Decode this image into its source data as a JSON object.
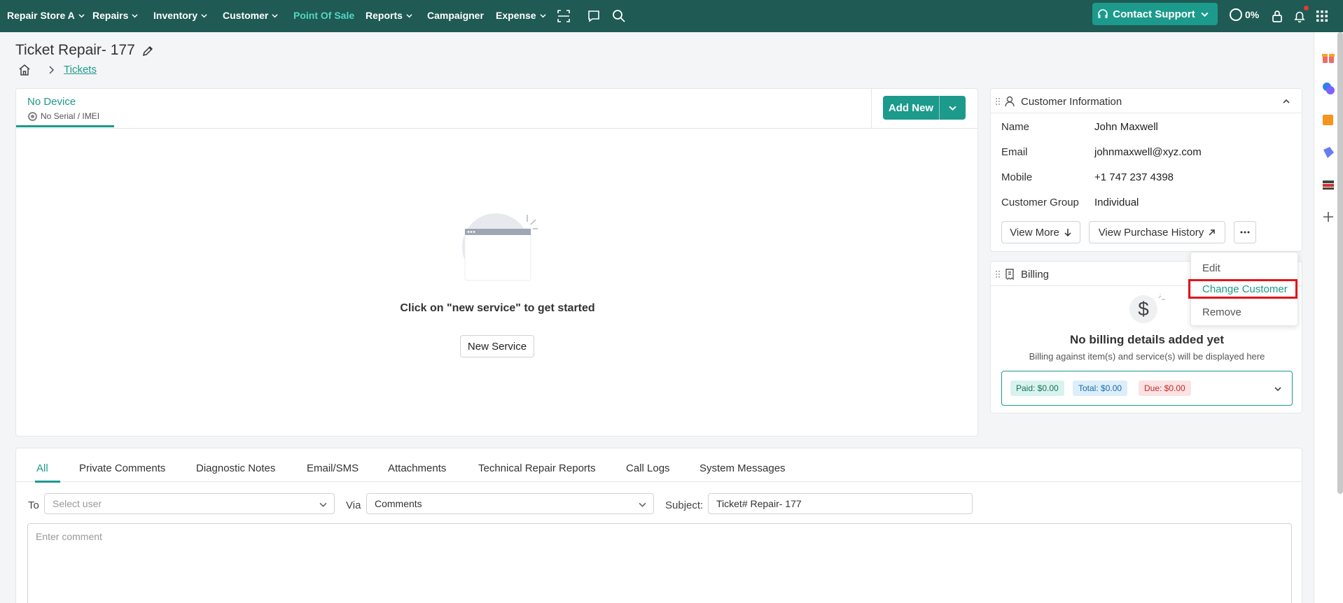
{
  "nav": {
    "store": "Repair Store A",
    "repairs": "Repairs",
    "inventory": "Inventory",
    "customer": "Customer",
    "pos": "Point Of Sale",
    "reports": "Reports",
    "campaigner": "Campaigner",
    "expense": "Expense",
    "contact_support": "Contact Support",
    "progress": "0%",
    "colors": {
      "bar": "#1f5a54",
      "accent": "#1c9a8c",
      "active": "#55d6c2"
    }
  },
  "header": {
    "title": "Ticket Repair- 177",
    "breadcrumb_link": "Tickets"
  },
  "device": {
    "name": "No Device",
    "serial": "No Serial / IMEI",
    "add_new": "Add New",
    "empty_text": "Click on \"new service\" to get started",
    "new_service": "New Service"
  },
  "customer_info": {
    "title": "Customer Information",
    "rows": [
      {
        "label": "Name",
        "value": "John Maxwell"
      },
      {
        "label": "Email",
        "value": "johnmaxwell@xyz.com"
      },
      {
        "label": "Mobile",
        "value": "+1 747 237 4398"
      },
      {
        "label": "Customer Group",
        "value": "Individual"
      }
    ],
    "view_more": "View More",
    "view_history": "View Purchase History"
  },
  "menu": {
    "items": [
      "Edit",
      "Change Customer",
      "Remove"
    ],
    "highlighted": "Change Customer"
  },
  "billing": {
    "title": "Billing",
    "empty_title": "No billing details added yet",
    "empty_sub": "Billing against item(s) and service(s) will be displayed here",
    "paid": "Paid: $0.00",
    "total": "Total: $0.00",
    "due": "Due: $0.00"
  },
  "comments": {
    "tabs": [
      "All",
      "Private Comments",
      "Diagnostic Notes",
      "Email/SMS",
      "Attachments",
      "Technical Repair Reports",
      "Call Logs",
      "System Messages"
    ],
    "active_tab": "All",
    "to_label": "To",
    "to_placeholder": "Select user",
    "via_label": "Via",
    "via_value": "Comments",
    "subject_label": "Subject:",
    "subject_value": "Ticket# Repair- 177",
    "comment_placeholder": "Enter comment"
  }
}
